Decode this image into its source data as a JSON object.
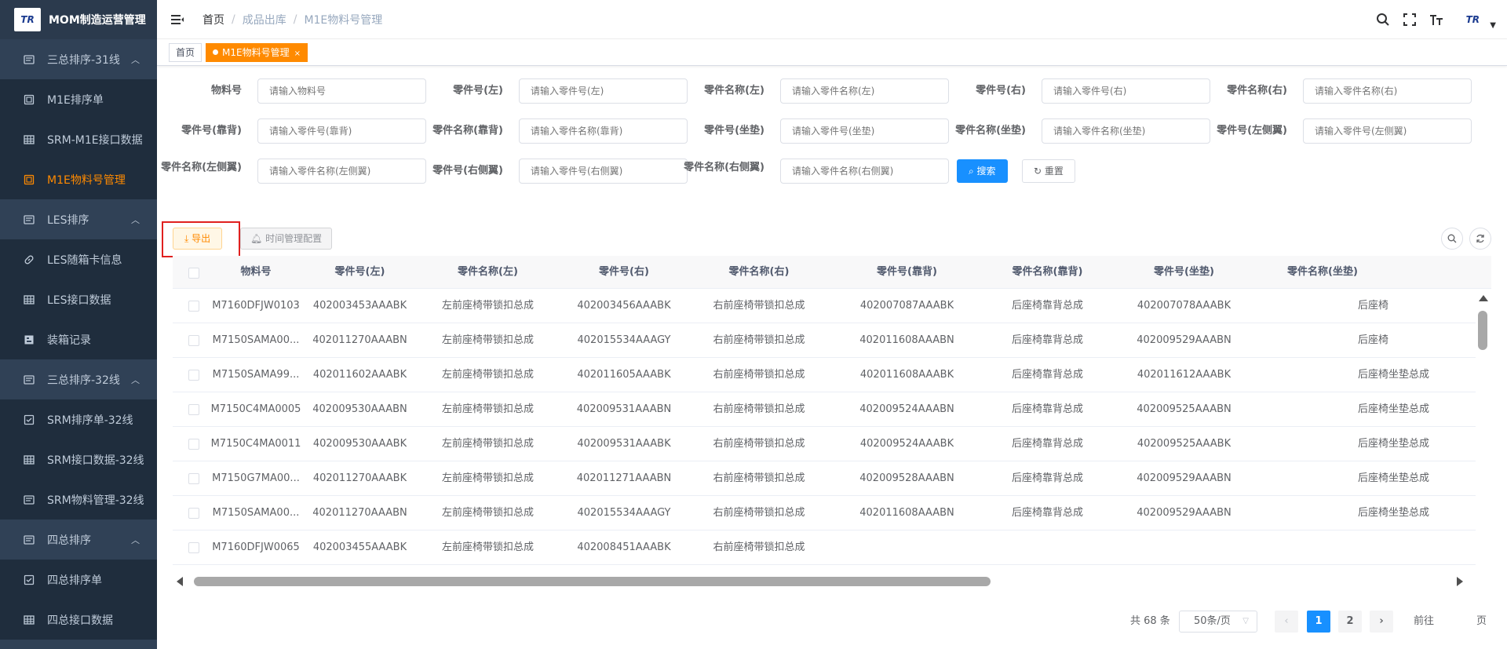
{
  "app": {
    "logo_text": "TR",
    "title": "MOM制造运营管理"
  },
  "sidebar": {
    "items": [
      {
        "label": "三总排序-31线",
        "icon": "list-icon",
        "group": true,
        "expanded": true
      },
      {
        "label": "M1E排序单",
        "icon": "doc-icon"
      },
      {
        "label": "SRM-M1E接口数据",
        "icon": "table-icon"
      },
      {
        "label": "M1E物料号管理",
        "icon": "doc-icon",
        "active": true
      },
      {
        "label": "LES排序",
        "icon": "list-icon",
        "group": true,
        "expanded": true
      },
      {
        "label": "LES随箱卡信息",
        "icon": "link-icon"
      },
      {
        "label": "LES接口数据",
        "icon": "table-icon"
      },
      {
        "label": "装箱记录",
        "icon": "box-icon"
      },
      {
        "label": "三总排序-32线",
        "icon": "list-icon",
        "group": true,
        "expanded": true
      },
      {
        "label": "SRM排序单-32线",
        "icon": "check-icon"
      },
      {
        "label": "SRM接口数据-32线",
        "icon": "table-icon"
      },
      {
        "label": "SRM物料管理-32线",
        "icon": "list-icon"
      },
      {
        "label": "四总排序",
        "icon": "list-icon",
        "group": true,
        "expanded": true
      },
      {
        "label": "四总排序单",
        "icon": "check-icon"
      },
      {
        "label": "四总接口数据",
        "icon": "table-icon"
      }
    ]
  },
  "header": {
    "breadcrumb": [
      "首页",
      "成品出库",
      "M1E物料号管理"
    ],
    "avatar_text": "TR"
  },
  "tags": {
    "home": "首页",
    "active": "M1E物料号管理",
    "close": "×"
  },
  "form": {
    "fields": [
      {
        "label": "物料号",
        "placeholder": "请输入物料号"
      },
      {
        "label": "零件号(左)",
        "placeholder": "请输入零件号(左)"
      },
      {
        "label": "零件名称(左)",
        "placeholder": "请输入零件名称(左)"
      },
      {
        "label": "零件号(右)",
        "placeholder": "请输入零件号(右)"
      },
      {
        "label": "零件名称(右)",
        "placeholder": "请输入零件名称(右)"
      },
      {
        "label": "零件号(靠背)",
        "placeholder": "请输入零件号(靠背)"
      },
      {
        "label": "零件名称(靠背)",
        "placeholder": "请输入零件名称(靠背)"
      },
      {
        "label": "零件号(坐垫)",
        "placeholder": "请输入零件号(坐垫)"
      },
      {
        "label": "零件名称(坐垫)",
        "placeholder": "请输入零件名称(坐垫)"
      },
      {
        "label": "零件号(左侧翼)",
        "placeholder": "请输入零件号(左侧翼)"
      },
      {
        "label": "零件名称(左侧翼)",
        "placeholder": "请输入零件名称(左侧翼)"
      },
      {
        "label": "零件号(右侧翼)",
        "placeholder": "请输入零件号(右侧翼)"
      },
      {
        "label": "零件名称(右侧翼)",
        "placeholder": "请输入零件名称(右侧翼)"
      }
    ],
    "search_label": "搜索",
    "reset_label": "重置"
  },
  "toolbar": {
    "export_label": "导出",
    "time_config_label": "时间管理配置"
  },
  "table": {
    "columns": [
      "物料号",
      "零件号(左)",
      "零件名称(左)",
      "零件号(右)",
      "零件名称(右)",
      "零件号(靠背)",
      "零件名称(靠背)",
      "零件号(坐垫)",
      "零件名称(坐垫)"
    ],
    "rows": [
      [
        "M7160DFJW0103",
        "402003453AAABK",
        "左前座椅带锁扣总成",
        "402003456AAABK",
        "右前座椅带锁扣总成",
        "402007087AAABK",
        "后座椅靠背总成",
        "402007078AAABK",
        "后座椅"
      ],
      [
        "M7150SAMA00...",
        "402011270AAABN",
        "左前座椅带锁扣总成",
        "402015534AAAGY",
        "右前座椅带锁扣总成",
        "402011608AAABN",
        "后座椅靠背总成",
        "402009529AAABN",
        "后座椅"
      ],
      [
        "M7150SAMA99...",
        "402011602AAABK",
        "左前座椅带锁扣总成",
        "402011605AAABK",
        "右前座椅带锁扣总成",
        "402011608AAABK",
        "后座椅靠背总成",
        "402011612AAABK",
        "后座椅坐垫总成"
      ],
      [
        "M7150C4MA0005",
        "402009530AAABN",
        "左前座椅带锁扣总成",
        "402009531AAABN",
        "右前座椅带锁扣总成",
        "402009524AAABN",
        "后座椅靠背总成",
        "402009525AAABN",
        "后座椅坐垫总成"
      ],
      [
        "M7150C4MA0011",
        "402009530AAABK",
        "左前座椅带锁扣总成",
        "402009531AAABK",
        "右前座椅带锁扣总成",
        "402009524AAABK",
        "后座椅靠背总成",
        "402009525AAABK",
        "后座椅坐垫总成"
      ],
      [
        "M7150G7MA00...",
        "402011270AAABK",
        "左前座椅带锁扣总成",
        "402011271AAABN",
        "右前座椅带锁扣总成",
        "402009528AAABN",
        "后座椅靠背总成",
        "402009529AAABN",
        "后座椅坐垫总成"
      ],
      [
        "M7150SAMA00...",
        "402011270AAABN",
        "左前座椅带锁扣总成",
        "402015534AAAGY",
        "右前座椅带锁扣总成",
        "402011608AAABN",
        "后座椅靠背总成",
        "402009529AAABN",
        "后座椅坐垫总成"
      ],
      [
        "M7160DFJW0065",
        "402003455AAABK",
        "左前座椅带锁扣总成",
        "402008451AAABK",
        "右前座椅带锁扣总成",
        "",
        "",
        "",
        ""
      ]
    ]
  },
  "pagination": {
    "total": "共 68 条",
    "page_size": "50条/页",
    "pages": [
      "1",
      "2"
    ],
    "current": "1",
    "goto": "前往",
    "page_unit": "页"
  },
  "colors": {
    "sidebar_bg": "#304156",
    "accent_orange": "#ff8a00",
    "primary_blue": "#1890ff",
    "highlight_red": "#e0201f"
  }
}
